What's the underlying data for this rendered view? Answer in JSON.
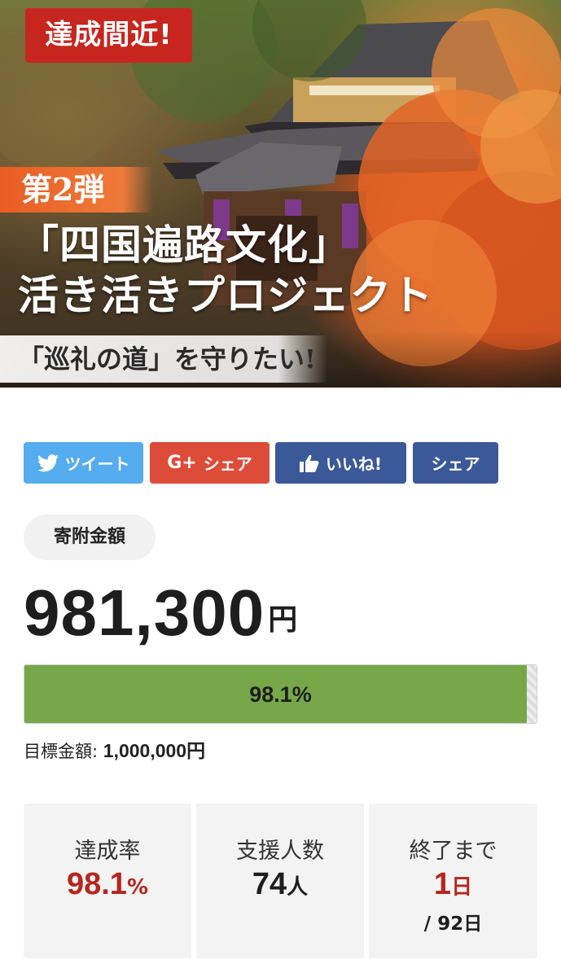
{
  "hero": {
    "badge": "達成間近!",
    "series": "第2弾",
    "title_line1": "「四国遍路文化」",
    "title_line2": "活き活きプロジェクト",
    "tagline": "「巡礼の道」を守りたい!"
  },
  "share": {
    "tweet": "ツイート",
    "gplus_mark": "G+",
    "gplus_share": "シェア",
    "like": "いいね!",
    "fb_share": "シェア",
    "colors": {
      "twitter": "#55acee",
      "gplus": "#dd4b39",
      "facebook": "#3b5998"
    }
  },
  "funding": {
    "pill_label": "寄附金額",
    "amount": "981,300",
    "amount_unit": "円",
    "progress_label": "98.1%",
    "progress_fraction": 0.981,
    "goal_label": "目標金額:",
    "goal_value": "1,000,000円",
    "progress_color": "#76a84a"
  },
  "stats": {
    "rate": {
      "label": "達成率",
      "value": "98.1",
      "unit": "%"
    },
    "supporters": {
      "label": "支援人数",
      "value": "74",
      "unit": "人"
    },
    "remaining": {
      "label": "終了まで",
      "value": "1",
      "unit": "日",
      "total": "/ 92日"
    },
    "accent_color": "#b5261e"
  }
}
